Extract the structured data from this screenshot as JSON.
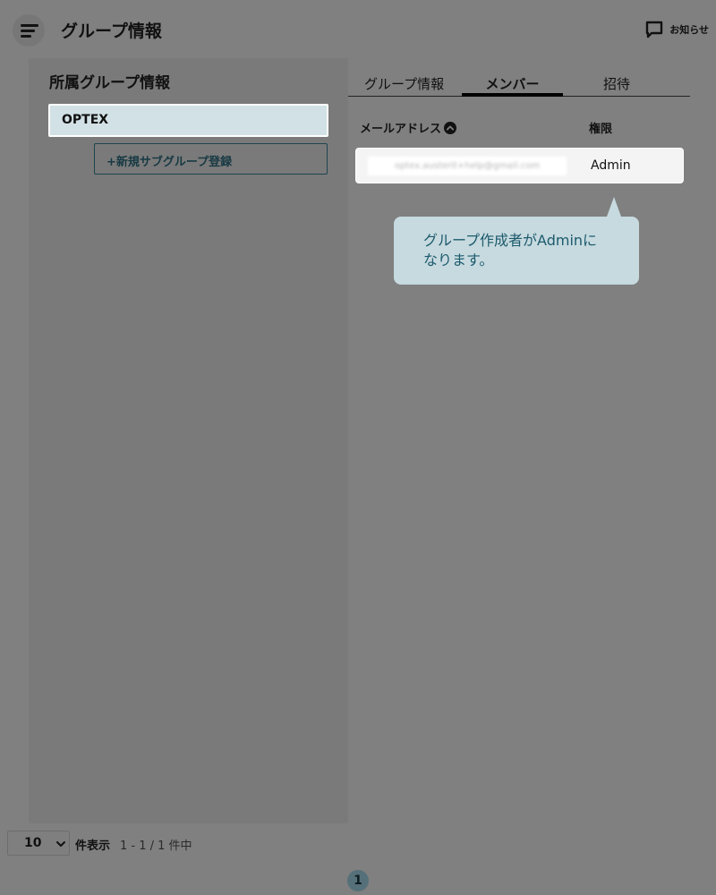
{
  "header": {
    "title": "グループ情報",
    "notice_label": "お知らせ"
  },
  "left_panel": {
    "title": "所属グループ情報",
    "groups": [
      {
        "name": "OPTEX"
      }
    ],
    "new_subgroup_label": "+新規サブグループ登録"
  },
  "tabs": [
    {
      "label": "グループ情報",
      "active": false
    },
    {
      "label": "メンバー",
      "active": true
    },
    {
      "label": "招待",
      "active": false
    }
  ],
  "members_table": {
    "headers": {
      "email": "メールアドレス",
      "role": "権限"
    },
    "rows": [
      {
        "email": "optex.austerit+help@gmail.com",
        "role": "Admin"
      }
    ]
  },
  "tooltip": {
    "line1": "グループ作成者がAdminに",
    "line2": "なります。"
  },
  "pagination": {
    "per_page": "10",
    "per_page_label": "件表示",
    "range_text": "1 - 1 / 1 件中",
    "current_page": "1"
  },
  "colors": {
    "overlay": "#808080",
    "accent_teal": "#1d5a6d",
    "tooltip_bg": "#c6dadf",
    "selected_group_bg": "#d2e1e5"
  }
}
